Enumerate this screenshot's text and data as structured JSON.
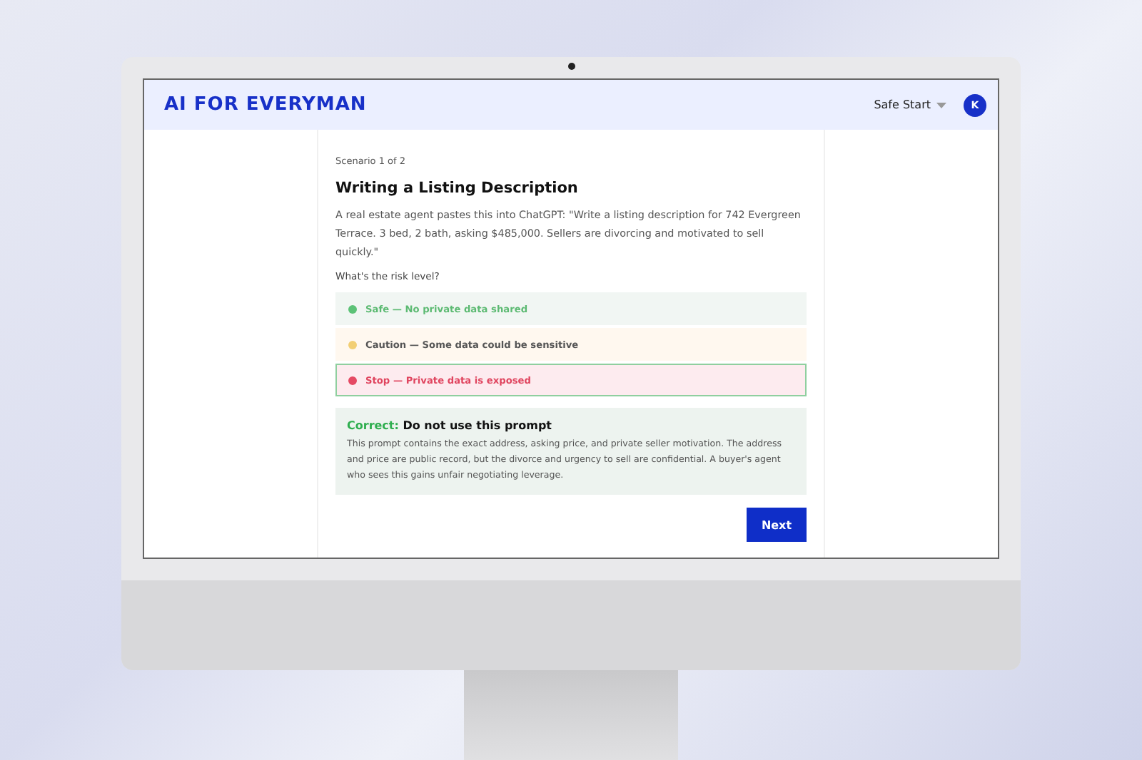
{
  "header": {
    "logo": "AI FOR EVERYMAN",
    "menu": "Safe Start",
    "avatar": "K"
  },
  "scenario": {
    "progress": "Scenario 1 of 2",
    "title": "Writing a Listing Description",
    "prompt": "A real estate agent pastes this into ChatGPT: \"Write a listing description for 742 Evergreen Terrace. 3 bed, 2 bath, asking $485,000. Sellers are divorcing and motivated to sell quickly.\"",
    "question": "What's the risk level?"
  },
  "options": [
    {
      "kind": "safe",
      "label": "Safe — No private data shared",
      "selected": false
    },
    {
      "kind": "caution",
      "label": "Caution — Some data could be sensitive",
      "selected": false
    },
    {
      "kind": "stop",
      "label": "Stop — Private data is exposed",
      "selected": true
    }
  ],
  "feedback": {
    "verdict": "Correct:",
    "title": "Do not use this prompt",
    "body": "This prompt contains the exact address, asking price, and private seller motivation. The address and price are public record, but the divorce and urgency to sell are confidential. A buyer's agent who sees this gains unfair negotiating leverage."
  },
  "next_button": "Next"
}
